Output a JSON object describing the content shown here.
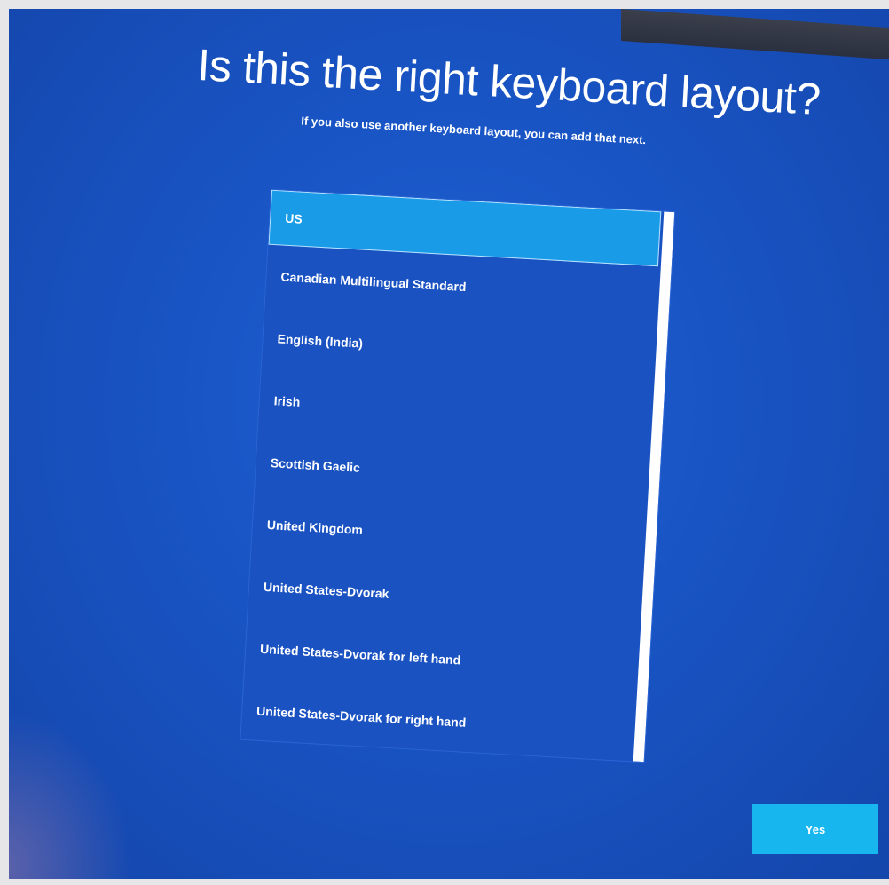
{
  "page": {
    "title": "Is this the right keyboard layout?",
    "subtitle": "If you also use another keyboard layout, you can add that next."
  },
  "layout_list": {
    "selected_value": "US",
    "items": [
      {
        "label": "US"
      },
      {
        "label": "Canadian Multilingual Standard"
      },
      {
        "label": "English (India)"
      },
      {
        "label": "Irish"
      },
      {
        "label": "Scottish Gaelic"
      },
      {
        "label": "United Kingdom"
      },
      {
        "label": "United States-Dvorak"
      },
      {
        "label": "United States-Dvorak for left hand"
      },
      {
        "label": "United States-Dvorak for right hand"
      }
    ]
  },
  "buttons": {
    "yes_label": "Yes"
  },
  "colors": {
    "background": "#1954c4",
    "selected_item": "#1a9be8",
    "primary_button": "#18b6ee",
    "text": "#ffffff"
  }
}
